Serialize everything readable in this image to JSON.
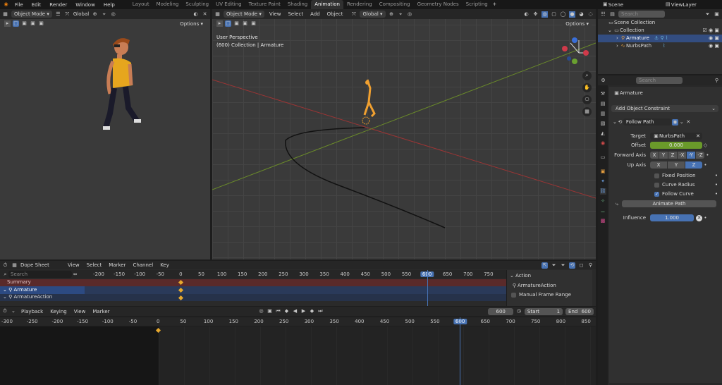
{
  "topbar": {
    "menus": [
      "File",
      "Edit",
      "Render",
      "Window",
      "Help"
    ],
    "workspaces": [
      "Layout",
      "Modeling",
      "Sculpting",
      "UV Editing",
      "Texture Paint",
      "Shading",
      "Animation",
      "Rendering",
      "Compositing",
      "Geometry Nodes",
      "Scripting"
    ],
    "active": "Animation",
    "scene": "Scene",
    "view_layer": "ViewLayer"
  },
  "left_view": {
    "mode": "Object Mode",
    "orientation": "Global",
    "options": "Options"
  },
  "main_view": {
    "mode": "Object Mode",
    "menus": [
      "View",
      "Select",
      "Add",
      "Object"
    ],
    "orientation": "Global",
    "options": "Options",
    "overlay_title": "User Perspective",
    "overlay_sub": "(600) Collection | Armature"
  },
  "outliner": {
    "search": "Search",
    "items": [
      "Scene Collection",
      "Collection",
      "Armature",
      "NurbsPath"
    ]
  },
  "properties": {
    "search": "Search",
    "object": "Armature",
    "add_constraint": "Add Object Constraint",
    "constraint": "Follow Path",
    "target_label": "Target",
    "target": "NurbsPath",
    "offset_label": "Offset",
    "offset": "0.000",
    "forward_label": "Forward Axis",
    "forward_axes": [
      "X",
      "Y",
      "Z",
      "-X",
      "-Y",
      "-Z"
    ],
    "forward_selected": "-Y",
    "up_label": "Up Axis",
    "up_axes": [
      "X",
      "Y",
      "Z"
    ],
    "up_selected": "Z",
    "fixed": "Fixed Position",
    "radius": "Curve Radius",
    "follow": "Follow Curve",
    "animate": "Animate Path",
    "influence_label": "Influence",
    "influence": "1.000"
  },
  "dopesheet": {
    "editor": "Dope Sheet",
    "menus": [
      "View",
      "Select",
      "Marker",
      "Channel",
      "Key"
    ],
    "search": "Search",
    "ruler": [
      "-200",
      "-150",
      "-100",
      "-50",
      "0",
      "50",
      "100",
      "150",
      "200",
      "250",
      "300",
      "350",
      "400",
      "450",
      "500",
      "550",
      "600",
      "650",
      "700",
      "750"
    ],
    "current": "600",
    "channels": [
      "Summary",
      "Armature",
      "ArmatureAction"
    ],
    "side_title": "Action",
    "side_action": "ArmatureAction",
    "side_manual": "Manual Frame Range"
  },
  "timeline": {
    "menus": [
      "Playback",
      "Keying",
      "View",
      "Marker"
    ],
    "frame": "600",
    "start_label": "Start",
    "start": "1",
    "end_label": "End",
    "end": "600",
    "ruler": [
      "-300",
      "-250",
      "-200",
      "-150",
      "-100",
      "-50",
      "0",
      "50",
      "100",
      "150",
      "200",
      "250",
      "300",
      "350",
      "400",
      "450",
      "500",
      "550",
      "600",
      "650",
      "700",
      "750",
      "800",
      "850"
    ],
    "current": "600"
  }
}
